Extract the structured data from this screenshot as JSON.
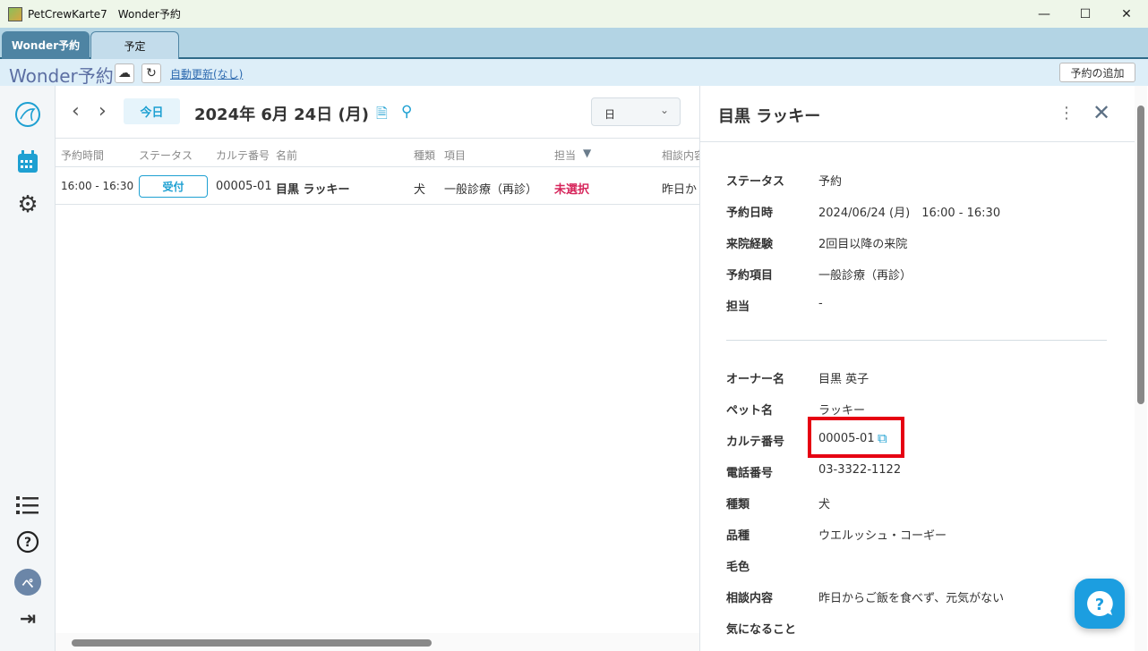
{
  "window": {
    "title": "PetCrewKarte7　Wonder予約",
    "controls": {
      "minimize": "—",
      "maximize": "☐",
      "close": "✕"
    }
  },
  "tabs": [
    {
      "label": "Wonder予約",
      "active": true
    },
    {
      "label": "予定",
      "active": false
    }
  ],
  "toolbar": {
    "title": "Wonder予約",
    "auto_refresh": "自動更新(なし)",
    "add_button": "予約の追加"
  },
  "sidebar": {
    "icons": [
      "logo-icon",
      "calendar-icon",
      "gear-icon",
      "list-icon",
      "help-circle-icon",
      "user-avatar-icon",
      "logout-icon"
    ],
    "avatar_text": "ぺ"
  },
  "main": {
    "today_label": "今日",
    "date": "2024年 6月 24日 (月)",
    "view_select": "日",
    "columns": [
      "予約時間",
      "ステータス",
      "カルテ番号",
      "名前",
      "種類",
      "項目",
      "担当",
      "相談内容"
    ],
    "rows": [
      {
        "time": "16:00 - 16:30",
        "status": "受付",
        "karte": "00005-01",
        "name": "目黒 ラッキー",
        "kind": "犬",
        "item": "一般診療（再診）",
        "staff": "未選択",
        "consult": "昨日か"
      }
    ]
  },
  "detail": {
    "title": "目黒 ラッキー",
    "fields1": [
      {
        "label": "ステータス",
        "value": "予約"
      },
      {
        "label": "予約日時",
        "value": "2024/06/24 (月)　16:00 - 16:30"
      },
      {
        "label": "来院経験",
        "value": "2回目以降の来院"
      },
      {
        "label": "予約項目",
        "value": "一般診療（再診）"
      },
      {
        "label": "担当",
        "value": "-"
      }
    ],
    "fields2": [
      {
        "label": "オーナー名",
        "value": "目黒 英子"
      },
      {
        "label": "ペット名",
        "value": "ラッキー"
      },
      {
        "label": "カルテ番号",
        "value": "00005-01"
      },
      {
        "label": "電話番号",
        "value": "03-3322-1122"
      },
      {
        "label": "種類",
        "value": "犬"
      },
      {
        "label": "品種",
        "value": "ウエルッシュ・コーギー"
      },
      {
        "label": "毛色",
        "value": ""
      },
      {
        "label": "相談内容",
        "value": "昨日からご飯を食べず、元気がない"
      },
      {
        "label": "気になること",
        "value": ""
      }
    ]
  },
  "colors": {
    "accent": "#1ea0d2",
    "warning": "#d6245a",
    "highlight": "#e60012",
    "tab_active": "#4e84a3"
  }
}
